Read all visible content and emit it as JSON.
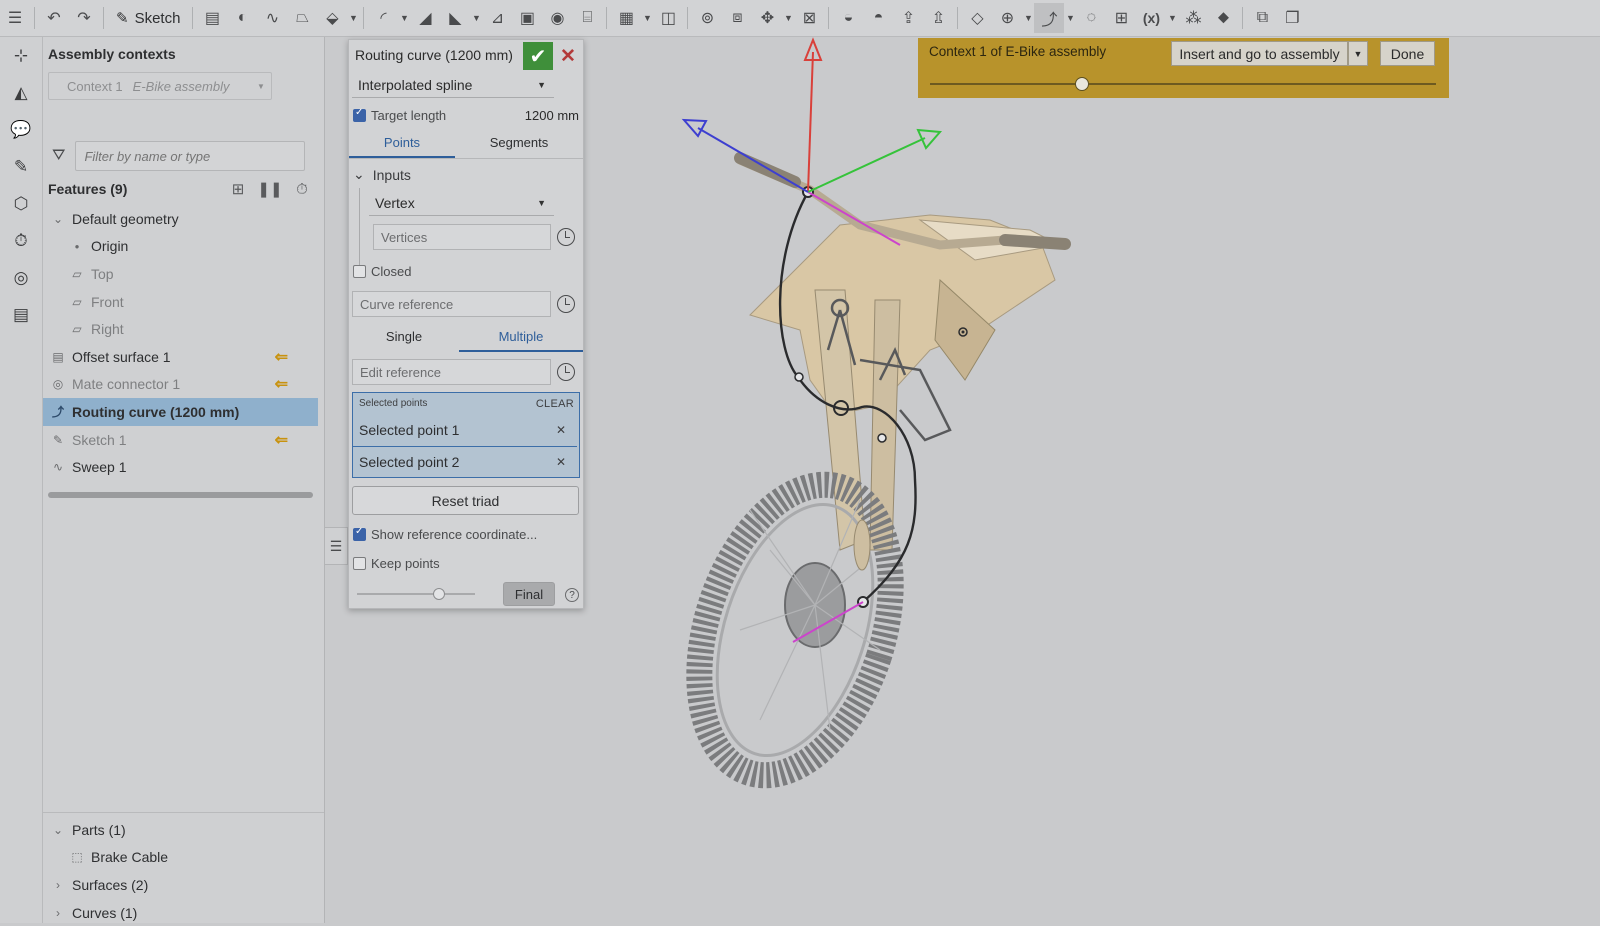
{
  "toolbar": {
    "sketch_label": "Sketch"
  },
  "feature_panel": {
    "contexts_title": "Assembly contexts",
    "context_select": {
      "value": "Context 1",
      "assembly": "E-Bike assembly"
    },
    "filter_placeholder": "Filter by name or type",
    "features_label": "Features (9)",
    "tree": [
      {
        "label": "Default geometry",
        "kind": "group"
      },
      {
        "label": "Origin",
        "kind": "origin"
      },
      {
        "label": "Top",
        "kind": "plane"
      },
      {
        "label": "Front",
        "kind": "plane"
      },
      {
        "label": "Right",
        "kind": "plane"
      },
      {
        "label": "Offset surface 1",
        "kind": "surface"
      },
      {
        "label": "Mate connector 1",
        "kind": "mate"
      },
      {
        "label": "Routing curve (1200 mm)",
        "kind": "curve",
        "selected": true
      },
      {
        "label": "Sketch 1",
        "kind": "sketch"
      },
      {
        "label": "Sweep 1",
        "kind": "sweep"
      }
    ],
    "parts_label": "Parts (1)",
    "part_item": "Brake Cable",
    "surfaces_label": "Surfaces (2)",
    "curves_label": "Curves (1)"
  },
  "dialog": {
    "title": "Routing curve (1200 mm)",
    "type_value": "Interpolated spline",
    "target_length_label": "Target length",
    "target_length_value": "1200 mm",
    "tabs": [
      "Points",
      "Segments"
    ],
    "inputs_label": "Inputs",
    "input_type": "Vertex",
    "vertices_placeholder": "Vertices",
    "closed_label": "Closed",
    "curve_reference_placeholder": "Curve reference",
    "mode_tabs": [
      "Single",
      "Multiple"
    ],
    "edit_reference_placeholder": "Edit reference",
    "selected_points_label": "Selected points",
    "clear_label": "CLEAR",
    "selected_points": [
      "Selected point 1",
      "Selected point 2"
    ],
    "reset_triad_label": "Reset triad",
    "show_reference_label": "Show reference coordinate...",
    "keep_points_label": "Keep points",
    "final_label": "Final",
    "help_icon": "?"
  },
  "context_banner": {
    "text": "Context 1 of E-Bike assembly",
    "insert_label": "Insert and go to assembly",
    "done_label": "Done",
    "slider_position": 0.3
  },
  "colors": {
    "accent_blue": "#2e5e9a",
    "confirm_green": "#3f8f3a",
    "cancel_red": "#b33a3a",
    "banner_gold": "#b8932b",
    "warning_arrow": "#c8920f",
    "triad_red": "#d9403a",
    "triad_green": "#35c33a",
    "triad_blue": "#3d3fd0",
    "curve_magenta": "#cc44cc"
  }
}
